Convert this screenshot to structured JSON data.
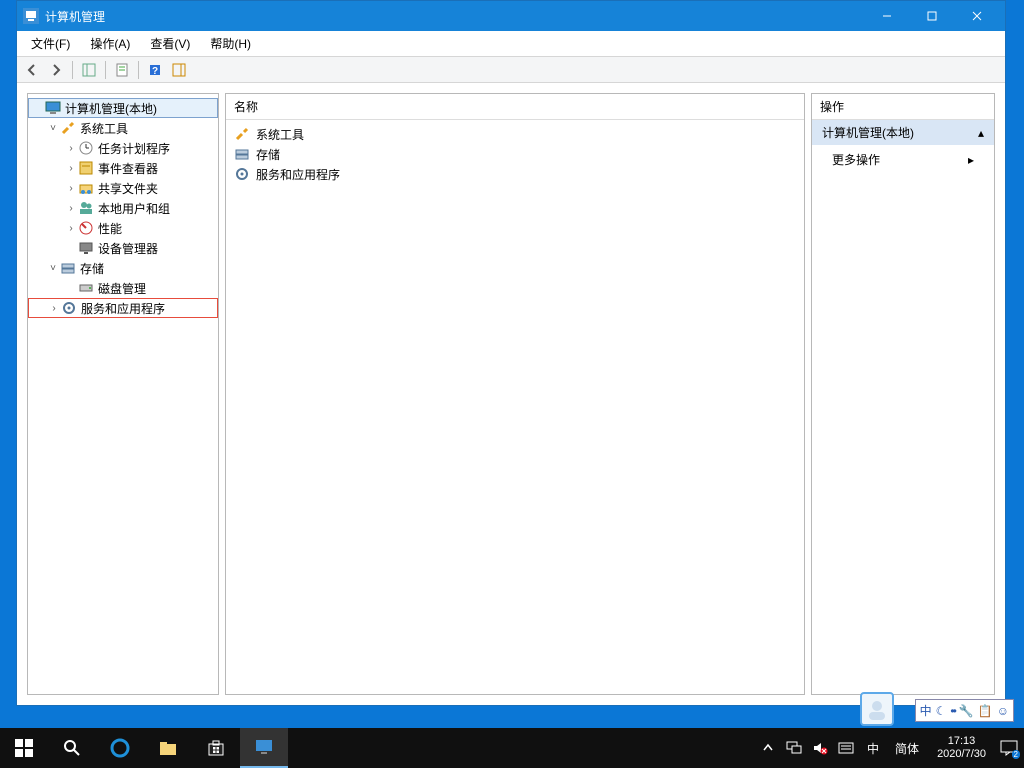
{
  "window": {
    "title": "计算机管理",
    "menus": [
      "文件(F)",
      "操作(A)",
      "查看(V)",
      "帮助(H)"
    ]
  },
  "tree": {
    "root": "计算机管理(本地)",
    "sysTools": "系统工具",
    "taskScheduler": "任务计划程序",
    "eventViewer": "事件查看器",
    "sharedFolders": "共享文件夹",
    "localUsersGroups": "本地用户和组",
    "performance": "性能",
    "deviceManager": "设备管理器",
    "storage": "存储",
    "diskMgmt": "磁盘管理",
    "servicesApps": "服务和应用程序"
  },
  "list": {
    "header": "名称",
    "items": [
      "系统工具",
      "存储",
      "服务和应用程序"
    ]
  },
  "actions": {
    "header": "操作",
    "section": "计算机管理(本地)",
    "more": "更多操作"
  },
  "taskbar": {
    "ime_lang": "中",
    "ime_mode": "简体",
    "time": "17:13",
    "date": "2020/7/30",
    "notif_count": "2"
  },
  "float_ime": {
    "lang": "中"
  }
}
